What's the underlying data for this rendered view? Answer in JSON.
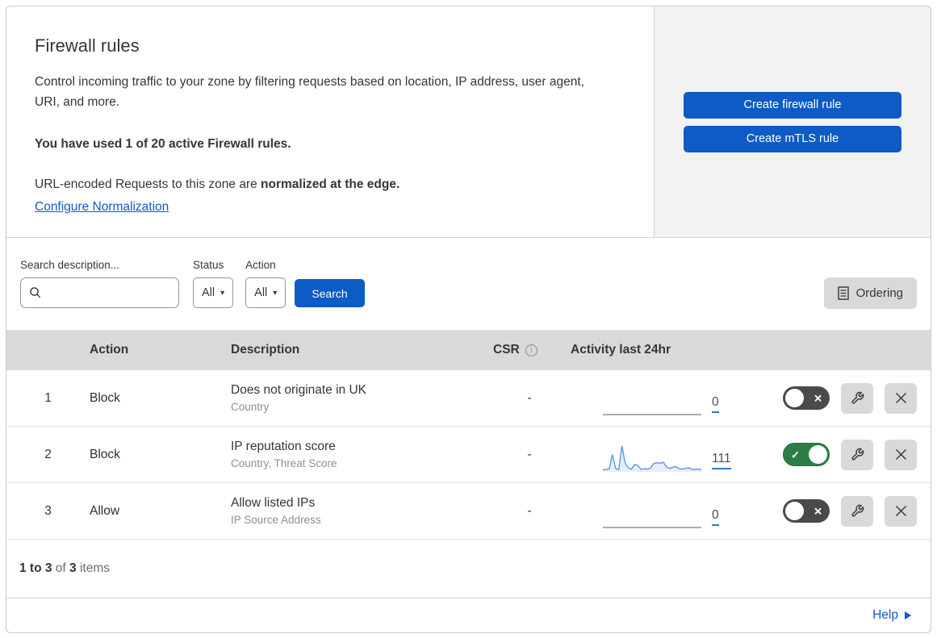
{
  "header": {
    "title": "Firewall rules",
    "description": "Control incoming traffic to your zone by filtering requests based on location, IP address, user agent, URI, and more.",
    "usage": "You have used 1 of 20 active Firewall rules.",
    "normalization_text": "URL-encoded Requests to this zone are ",
    "normalization_bold": "normalized at the edge.",
    "normalization_link": "Configure Normalization",
    "create_firewall_button": "Create firewall rule",
    "create_mtls_button": "Create mTLS rule"
  },
  "filters": {
    "search_label": "Search description...",
    "search_value": "",
    "status_label": "Status",
    "status_value": "All",
    "action_label": "Action",
    "action_value": "All",
    "search_button": "Search",
    "ordering_button": "Ordering"
  },
  "table": {
    "columns": {
      "action": "Action",
      "description": "Description",
      "csr": "CSR",
      "activity": "Activity last 24hr"
    },
    "rows": [
      {
        "number": "1",
        "action": "Block",
        "description": "Does not originate in UK",
        "fields": "Country",
        "csr": "-",
        "activity_count": "0",
        "enabled": false,
        "sparkline": null
      },
      {
        "number": "2",
        "action": "Block",
        "description": "IP reputation score",
        "fields": "Country, Threat Score",
        "csr": "-",
        "activity_count": "111",
        "enabled": true,
        "sparkline": [
          4,
          6,
          8,
          62,
          10,
          5,
          95,
          30,
          12,
          7,
          25,
          21,
          6,
          9,
          7,
          11,
          28,
          31,
          29,
          33,
          16,
          10,
          14,
          17,
          9,
          7,
          10,
          12,
          7,
          6,
          7,
          6
        ]
      },
      {
        "number": "3",
        "action": "Allow",
        "description": "Allow listed IPs",
        "fields": "IP Source Address",
        "csr": "-",
        "activity_count": "0",
        "enabled": false,
        "sparkline": null
      }
    ]
  },
  "footer": {
    "range": "1 to 3",
    "of": "of",
    "total": "3",
    "items": "items"
  },
  "help": {
    "label": "Help"
  },
  "icons": {
    "info_glyph": "i",
    "caret_glyph": "▾",
    "check_glyph": "✓",
    "cross_glyph": "✕"
  },
  "colors": {
    "accent_blue": "#0d5bc6",
    "toggle_on_green": "#2d7d46",
    "toggle_off_gray": "#4a4a4a",
    "spark_blue": "#6096dc",
    "table_header_gray": "#d9d9d9",
    "panel_gray": "#f2f2f2",
    "link_underline_blue": "#3575c9"
  }
}
